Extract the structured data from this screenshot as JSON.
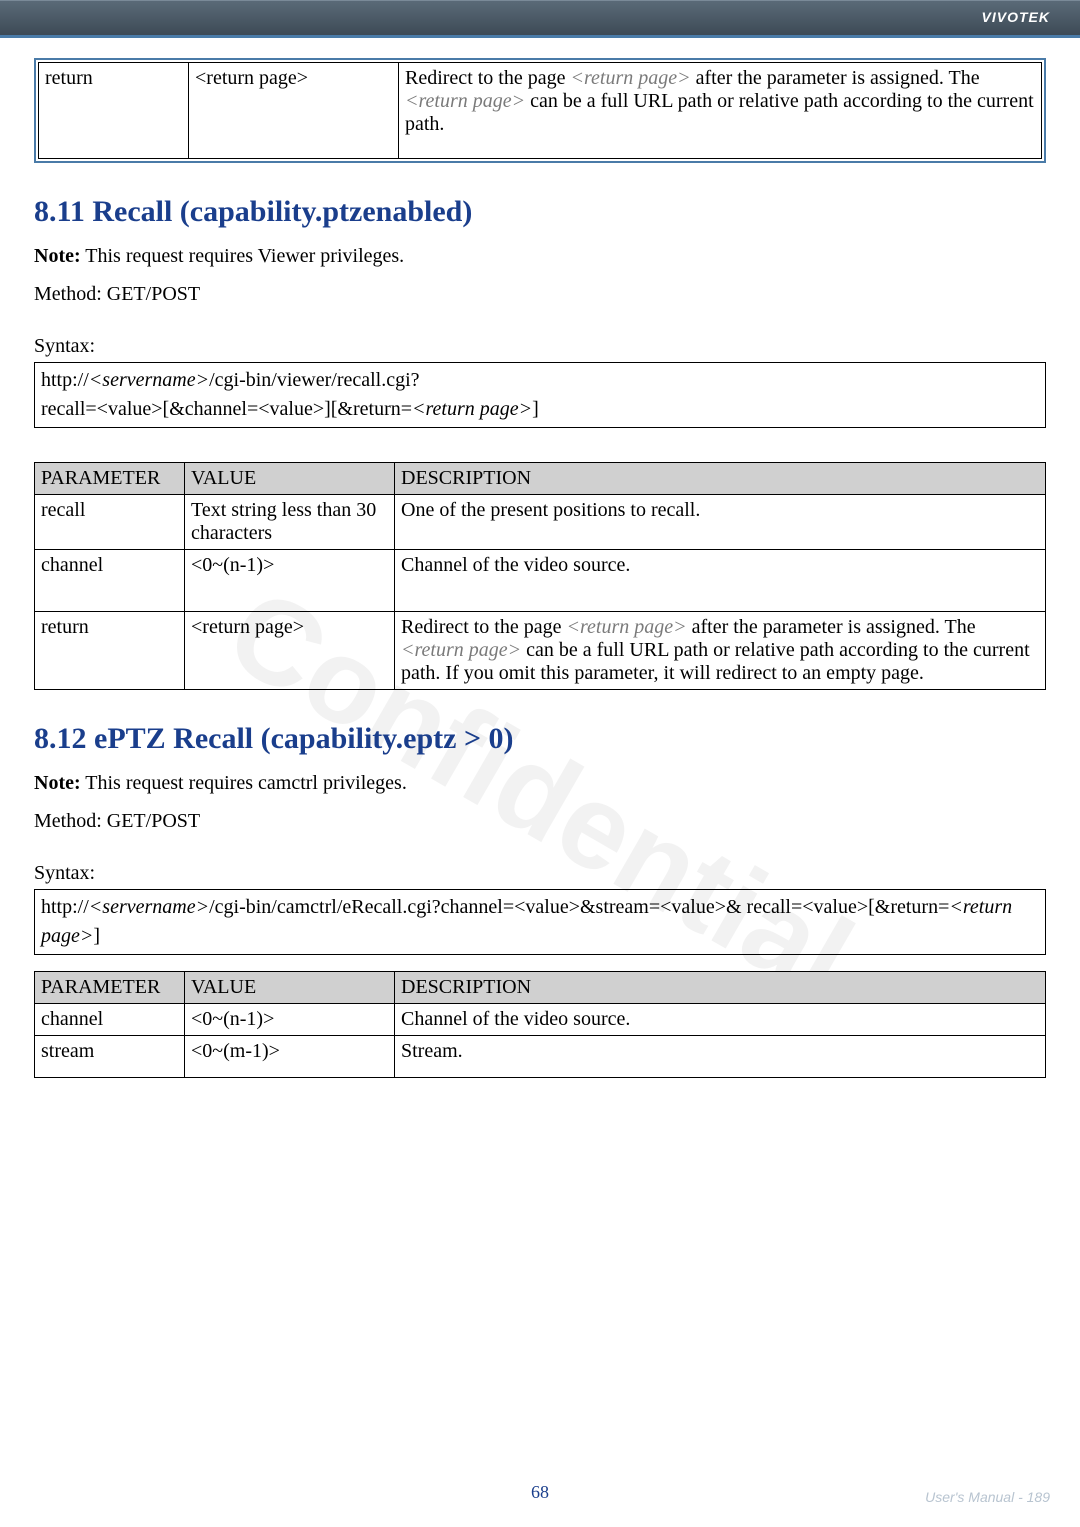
{
  "header": {
    "brand": "VIVOTEK"
  },
  "topTable": {
    "row": {
      "param": "return",
      "value": "<return page>",
      "desc": {
        "pre1": "Redirect to the page ",
        "rp1": "<return page>",
        "post1": " after the parameter is assigned. The ",
        "rp2": "<return page>",
        "post2": " can be a full URL path or relative path according to the current path."
      }
    }
  },
  "section811": {
    "title": "8.11 Recall (capability.ptzenabled)",
    "noteLabel": "Note:",
    "noteText": " This request requires Viewer privileges.",
    "method": "Method: GET/POST",
    "syntaxLabel": "Syntax:",
    "syntax": {
      "line1Pre": "http://",
      "server": "<servername>",
      "line1Post": "/cgi-bin/viewer/recall.cgi?",
      "line2Pre": "recall=<value>[&channel=<value>][&return=",
      "rp": "<return page>",
      "line2Post": "]"
    },
    "tableHead": {
      "p": "PARAMETER",
      "v": "VALUE",
      "d": "DESCRIPTION"
    },
    "rows": [
      {
        "param": "recall",
        "value": "Text string less than 30 characters",
        "desc": "One of the present positions to recall."
      },
      {
        "param": "channel",
        "value": "<0~(n-1)>",
        "desc": "Channel of the video source."
      }
    ],
    "row3": {
      "param": "return",
      "value": "<return page>",
      "desc": {
        "pre1": "Redirect to the page ",
        "rp1": "<return page>",
        "post1": " after the parameter is assigned. The ",
        "rp2": "<return page>",
        "post2": " can be a full URL path or relative path according to the current path. If you omit this parameter, it will redirect to an empty page."
      }
    }
  },
  "section812": {
    "title": "8.12 ePTZ Recall (capability.eptz > 0)",
    "noteLabel": "Note:",
    "noteText": " This request requires camctrl privileges.",
    "method": "Method: GET/POST",
    "syntaxLabel": "Syntax:",
    "syntax": {
      "pre": "http://",
      "server": "<servername>",
      "mid": "/cgi-bin/camctrl/eRecall.cgi?channel=<value>&stream=<value>& recall=<value>[&return=",
      "rp": "<return page>",
      "post": "]"
    },
    "tableHead": {
      "p": "PARAMETER",
      "v": "VALUE",
      "d": "DESCRIPTION"
    },
    "rows": [
      {
        "param": "channel",
        "value": "<0~(n-1)>",
        "desc": "Channel of the video source."
      },
      {
        "param": "stream",
        "value": "<0~(m-1)>",
        "desc": "Stream."
      }
    ]
  },
  "footer": {
    "pageNum": "68",
    "manual": "User's Manual - 189"
  }
}
